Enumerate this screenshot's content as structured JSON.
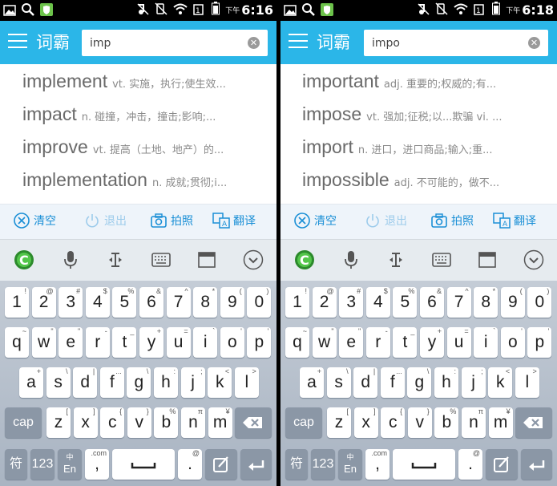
{
  "screens": [
    {
      "time": "6:16",
      "ampm": "下午",
      "app_title": "词霸",
      "query": "imp",
      "results": [
        {
          "word": "implement",
          "def": "vt. 实施，执行;使生效..."
        },
        {
          "word": "impact",
          "def": "n. 碰撞，冲击，撞击;影响;..."
        },
        {
          "word": "improve",
          "def": "vt. 提高（土地、地产）的..."
        },
        {
          "word": "implementation",
          "def": "n. 成就;贯彻;i..."
        }
      ]
    },
    {
      "time": "6:18",
      "ampm": "下午",
      "app_title": "词霸",
      "query": "impo",
      "results": [
        {
          "word": "important",
          "def": "adj. 重要的;权威的;有..."
        },
        {
          "word": "impose",
          "def": "vt. 强加;征税;以...欺骗 vi. ..."
        },
        {
          "word": "import",
          "def": "n. 进口，进口商品;输入;重..."
        },
        {
          "word": "impossible",
          "def": "adj. 不可能的，做不..."
        }
      ]
    }
  ],
  "actions": {
    "clear": "清空",
    "exit": "退出",
    "photo": "拍照",
    "translate": "翻译"
  },
  "keyboard": {
    "row1": [
      {
        "m": "1",
        "s": "!"
      },
      {
        "m": "2",
        "s": "@"
      },
      {
        "m": "3",
        "s": "#"
      },
      {
        "m": "4",
        "s": "$"
      },
      {
        "m": "5",
        "s": "%"
      },
      {
        "m": "6",
        "s": "&"
      },
      {
        "m": "7",
        "s": "^"
      },
      {
        "m": "8",
        "s": "*"
      },
      {
        "m": "9",
        "s": "("
      },
      {
        "m": "0",
        "s": ")"
      }
    ],
    "row2": [
      {
        "m": "q",
        "s": "~"
      },
      {
        "m": "w",
        "s": "\""
      },
      {
        "m": "e",
        "s": "\""
      },
      {
        "m": "r",
        "s": "-"
      },
      {
        "m": "t",
        "s": "_"
      },
      {
        "m": "y",
        "s": "+"
      },
      {
        "m": "u",
        "s": "="
      },
      {
        "m": "i",
        "s": "`"
      },
      {
        "m": "o",
        "s": "'"
      },
      {
        "m": "p",
        "s": "'"
      }
    ],
    "row3": [
      {
        "m": "a",
        "s": "+"
      },
      {
        "m": "s",
        "s": "\\"
      },
      {
        "m": "d",
        "s": "|"
      },
      {
        "m": "f",
        "s": "..."
      },
      {
        "m": "g",
        "s": "\\"
      },
      {
        "m": "h",
        "s": ":"
      },
      {
        "m": "j",
        "s": ";"
      },
      {
        "m": "k",
        "s": "<"
      },
      {
        "m": "l",
        "s": ">"
      }
    ],
    "row4": [
      {
        "m": "z",
        "s": "["
      },
      {
        "m": "x",
        "s": "]"
      },
      {
        "m": "c",
        "s": "{"
      },
      {
        "m": "v",
        "s": "}"
      },
      {
        "m": "b",
        "s": "%"
      },
      {
        "m": "n",
        "s": "π"
      },
      {
        "m": "m",
        "s": "¥"
      }
    ],
    "caps": "cap",
    "sym": "符",
    "num": "123",
    "lang_top": "中",
    "lang_bottom": "En",
    "com": ".com",
    "comma": ",",
    "dot": ".",
    "at": "@",
    "m_sub": "€"
  }
}
